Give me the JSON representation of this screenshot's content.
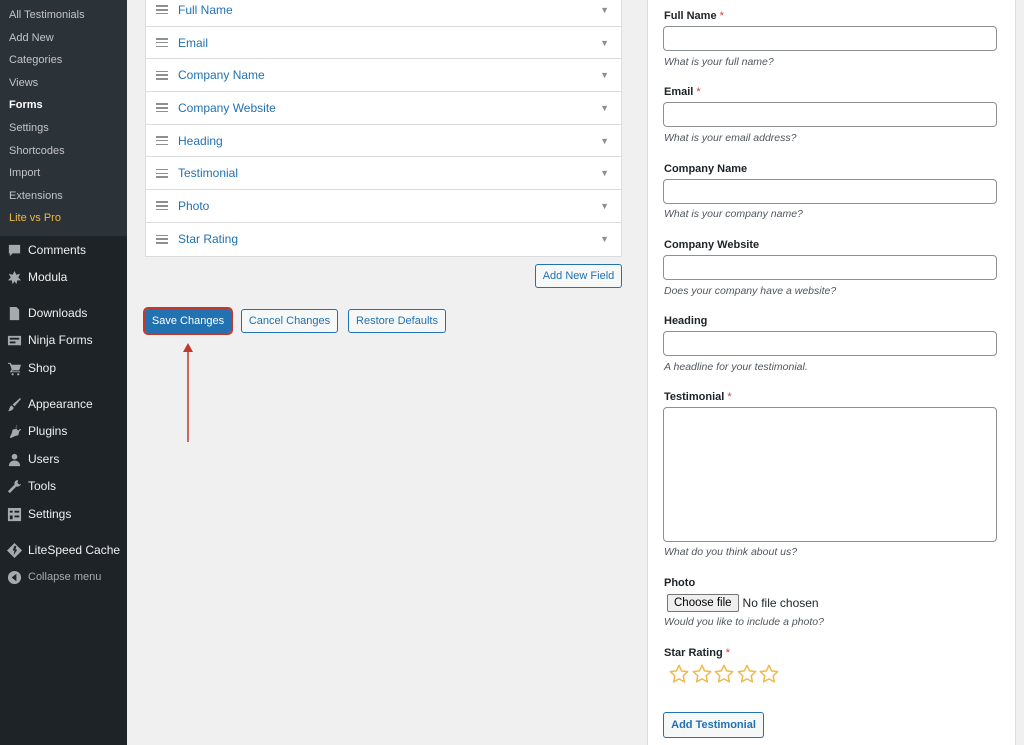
{
  "sidebar": {
    "submenu": [
      {
        "label": "All Testimonials",
        "current": false,
        "upsell": false
      },
      {
        "label": "Add New",
        "current": false,
        "upsell": false
      },
      {
        "label": "Categories",
        "current": false,
        "upsell": false
      },
      {
        "label": "Views",
        "current": false,
        "upsell": false
      },
      {
        "label": "Forms",
        "current": true,
        "upsell": false
      },
      {
        "label": "Settings",
        "current": false,
        "upsell": false
      },
      {
        "label": "Shortcodes",
        "current": false,
        "upsell": false
      },
      {
        "label": "Import",
        "current": false,
        "upsell": false
      },
      {
        "label": "Extensions",
        "current": false,
        "upsell": false
      },
      {
        "label": "Lite vs Pro",
        "current": false,
        "upsell": true
      }
    ],
    "menu": [
      {
        "label": "Comments",
        "icon": "comments-icon"
      },
      {
        "label": "Modula",
        "icon": "modula-icon"
      },
      {
        "label": "Downloads",
        "icon": "downloads-icon"
      },
      {
        "label": "Ninja Forms",
        "icon": "ninja-forms-icon"
      },
      {
        "label": "Shop",
        "icon": "shop-cart-icon"
      },
      {
        "label": "Appearance",
        "icon": "appearance-brush-icon"
      },
      {
        "label": "Plugins",
        "icon": "plugins-icon"
      },
      {
        "label": "Users",
        "icon": "users-icon"
      },
      {
        "label": "Tools",
        "icon": "tools-wrench-icon"
      },
      {
        "label": "Settings",
        "icon": "settings-icon"
      },
      {
        "label": "LiteSpeed Cache",
        "icon": "litespeed-icon"
      },
      {
        "label": "Collapse menu",
        "icon": "collapse-icon"
      }
    ]
  },
  "fields": [
    {
      "label": "Full Name"
    },
    {
      "label": "Email"
    },
    {
      "label": "Company Name"
    },
    {
      "label": "Company Website"
    },
    {
      "label": "Heading"
    },
    {
      "label": "Testimonial"
    },
    {
      "label": "Photo"
    },
    {
      "label": "Star Rating"
    }
  ],
  "actions": {
    "add_new_field": "Add New Field",
    "save_changes": "Save Changes",
    "cancel_changes": "Cancel Changes",
    "restore_defaults": "Restore Defaults"
  },
  "preview": {
    "fields": [
      {
        "label": "Full Name",
        "required": true,
        "required_mark": "*",
        "type": "text",
        "description": "What is your full name?"
      },
      {
        "label": "Email",
        "required": true,
        "required_mark": "*",
        "type": "text",
        "description": "What is your email address?"
      },
      {
        "label": "Company Name",
        "required": false,
        "required_mark": "",
        "type": "text",
        "description": "What is your company name?"
      },
      {
        "label": "Company Website",
        "required": false,
        "required_mark": "",
        "type": "text",
        "description": "Does your company have a website?"
      },
      {
        "label": "Heading",
        "required": false,
        "required_mark": "",
        "type": "text",
        "description": "A headline for your testimonial."
      },
      {
        "label": "Testimonial",
        "required": true,
        "required_mark": "*",
        "type": "textarea",
        "description": "What do you think about us?"
      },
      {
        "label": "Photo",
        "required": false,
        "required_mark": "",
        "type": "file",
        "description": "Would you like to include a photo?"
      },
      {
        "label": "Star Rating",
        "required": true,
        "required_mark": "*",
        "type": "rating",
        "description": ""
      }
    ],
    "file_button": "Choose file",
    "file_status": "No file chosen",
    "star_rating": {
      "value": 0,
      "max": 5
    },
    "submit_label": "Add Testimonial"
  },
  "colors": {
    "sidebar_bg": "#1d2327",
    "submenu_bg": "#2c3338",
    "link_blue": "#2271b1",
    "upsell_gold": "#f0b849",
    "required_red": "#d63638",
    "annotation_red": "#c0392b",
    "star_outline": "#f0b849"
  }
}
